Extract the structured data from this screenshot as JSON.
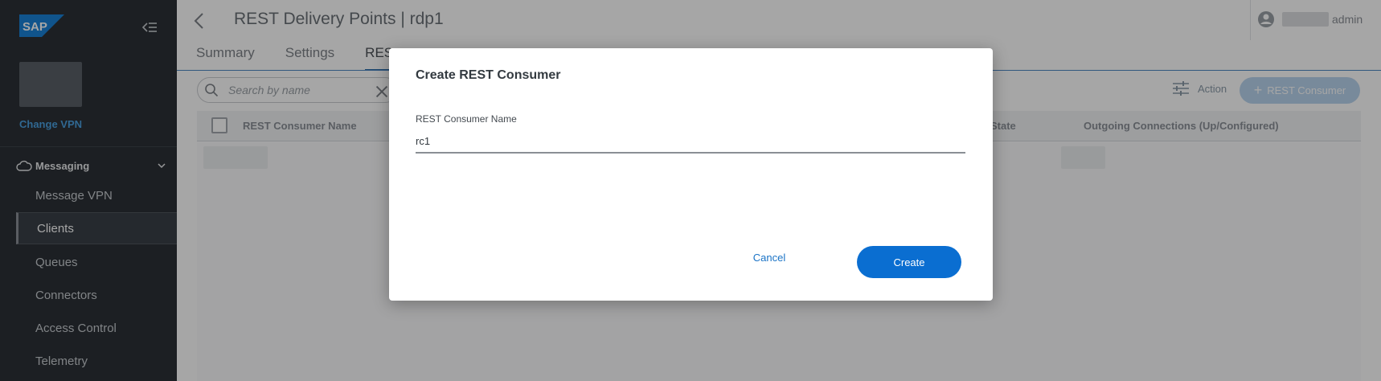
{
  "sidebar": {
    "logo_text": "SAP",
    "change_vpn_label": "Change VPN",
    "section_label": "Messaging",
    "items": [
      {
        "label": "Message VPN"
      },
      {
        "label": "Clients"
      },
      {
        "label": "Queues"
      },
      {
        "label": "Connectors"
      },
      {
        "label": "Access Control"
      },
      {
        "label": "Telemetry"
      }
    ]
  },
  "header": {
    "title": "REST Delivery Points | rdp1",
    "user": "admin"
  },
  "tabs": [
    {
      "label": "Summary"
    },
    {
      "label": "Settings"
    },
    {
      "label": "RES"
    }
  ],
  "toolbar": {
    "search_placeholder": "Search by name",
    "action_label": "Action",
    "add_label": "REST Consumer"
  },
  "table": {
    "columns": [
      "REST Consumer Name",
      "State",
      "Outgoing Connections (Up/Configured)"
    ]
  },
  "modal": {
    "title": "Create REST Consumer",
    "field_label": "REST Consumer Name",
    "field_value": "rc1",
    "cancel_label": "Cancel",
    "create_label": "Create"
  },
  "colors": {
    "sidebar_bg": "#2b3036",
    "accent": "#0a6ed1",
    "link": "#1a73c6"
  }
}
